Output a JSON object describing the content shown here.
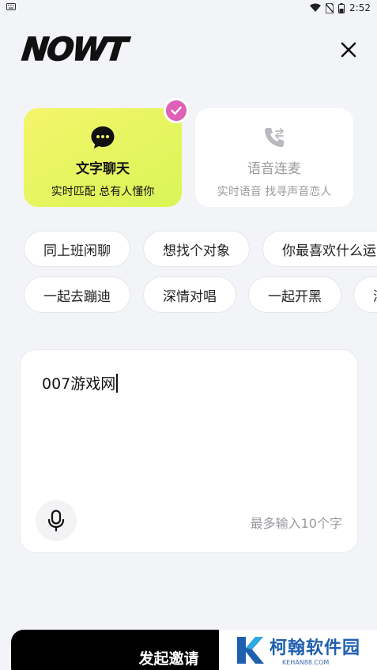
{
  "status_bar": {
    "time": "2:52"
  },
  "header": {
    "logo": "NOWT"
  },
  "modes": [
    {
      "title": "文字聊天",
      "subtitle": "实时匹配 总有人懂你",
      "selected": true
    },
    {
      "title": "语音连麦",
      "subtitle": "实时语音 找寻声音恋人",
      "selected": false
    }
  ],
  "topics_row1": [
    "同上班闲聊",
    "想找个对象",
    "你最喜欢什么运"
  ],
  "topics_row2": [
    "一起去蹦迪",
    "深情对唱",
    "一起开黑",
    "深"
  ],
  "input": {
    "value": "007游戏网",
    "limit_hint": "最多输入10个字"
  },
  "invite_button": {
    "label": "发起邀请"
  },
  "watermark": {
    "name": "柯翰软件园",
    "domain": "KEHAN88.COM"
  },
  "colors": {
    "accent_yellow": "#f4f56a",
    "badge_pink": "#e060b8",
    "watermark_blue": "#1f5fb0"
  }
}
